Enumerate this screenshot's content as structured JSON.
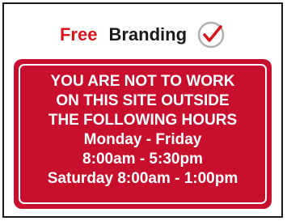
{
  "branding": {
    "free": "Free",
    "brand": "Branding",
    "icon": "check-circle-icon"
  },
  "sign": {
    "lines": [
      "YOU ARE NOT TO WORK",
      "ON THIS SITE OUTSIDE",
      "THE FOLLOWING HOURS",
      "Monday - Friday",
      "8:00am - 5:30pm",
      "Saturday 8:00am - 1:00pm"
    ]
  },
  "colors": {
    "sign_background": "#c8102e",
    "accent_red": "#d9141b",
    "text_dark": "#1a1a1a"
  }
}
